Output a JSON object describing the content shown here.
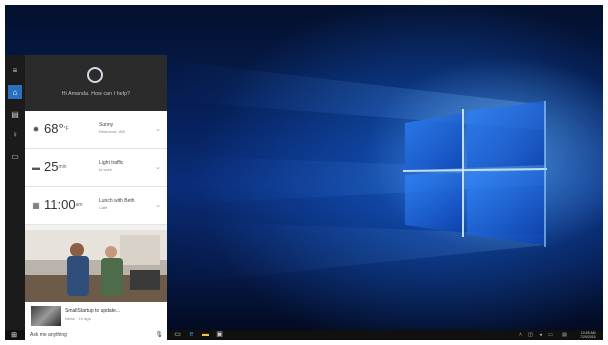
{
  "desktop": {
    "wallpaper": "windows-10-hero",
    "accent": "#2d6fbf"
  },
  "cortana": {
    "greeting": "Hi Amanda. How can I help?",
    "rail_icons": [
      "hamburger-icon",
      "home-icon",
      "notebook-icon",
      "lightbulb-icon",
      "feedback-icon"
    ],
    "cards": [
      {
        "icon": "weather-sun-icon",
        "value": "68°",
        "unit": "°F",
        "label": "Sunny",
        "sub": "Redmond, WA"
      },
      {
        "icon": "car-icon",
        "value": "25",
        "unit": "min",
        "label": "Light traffic",
        "sub": "to work"
      },
      {
        "icon": "calendar-icon",
        "value": "11:00",
        "unit": "am",
        "label": "Lunch with Beth",
        "sub": "Café"
      }
    ],
    "news": {
      "title": "SmallStartup to update...",
      "sub": "News · 1h ago"
    }
  },
  "taskbar": {
    "search_placeholder": "Ask me anything",
    "clock_time": "10:45 AM",
    "clock_date": "7/29/2015",
    "pinned": [
      "task-view-icon",
      "edge-icon",
      "file-explorer-icon",
      "store-icon"
    ],
    "tray": [
      "chevron-up-icon",
      "network-icon",
      "volume-icon",
      "keyboard-icon",
      "notification-icon"
    ]
  }
}
